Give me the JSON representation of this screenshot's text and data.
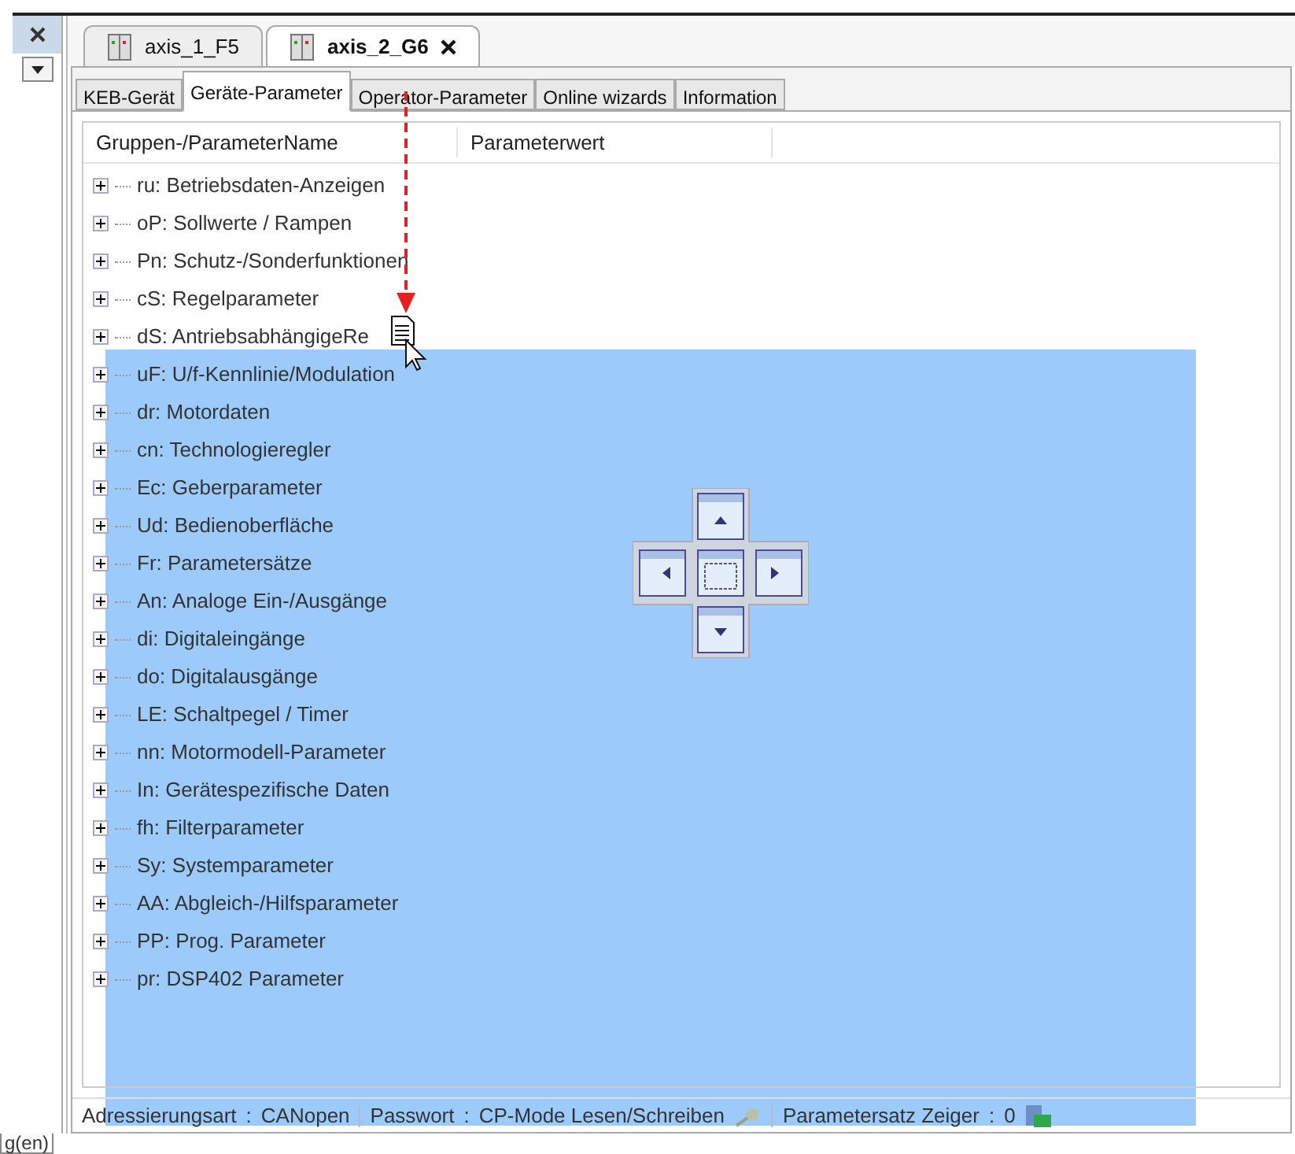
{
  "document_tabs": [
    {
      "label": "axis_1_F5",
      "selected": false
    },
    {
      "label": "axis_2_G6",
      "selected": true
    }
  ],
  "sub_tabs": [
    {
      "label": "KEB-Gerät",
      "selected": false
    },
    {
      "label": "Geräte-Parameter",
      "selected": true
    },
    {
      "label": "Operator-Parameter",
      "selected": false
    },
    {
      "label": "Online wizards",
      "selected": false
    },
    {
      "label": "Information",
      "selected": false
    }
  ],
  "columns": [
    "Gruppen-/ParameterName",
    "Parameterwert"
  ],
  "tree": [
    {
      "label": "ru: Betriebsdaten-Anzeigen",
      "expanded": false
    },
    {
      "label": "oP: Sollwerte / Rampen",
      "expanded": false
    },
    {
      "label": "Pn: Schutz-/Sonderfunktionen",
      "expanded": false
    },
    {
      "label": "cS: Regelparameter",
      "expanded": false
    },
    {
      "label": "dS: AntriebsabhängigeRe",
      "expanded": false
    },
    {
      "label": "uF: U/f-Kennlinie/Modulation",
      "expanded": false
    },
    {
      "label": "dr: Motordaten",
      "expanded": false
    },
    {
      "label": "cn: Technologieregler",
      "expanded": false
    },
    {
      "label": "Ec: Geberparameter",
      "expanded": false
    },
    {
      "label": "Ud: Bedienoberfläche",
      "expanded": false
    },
    {
      "label": "Fr: Parametersätze",
      "expanded": false
    },
    {
      "label": "An: Analoge Ein-/Ausgänge",
      "expanded": false
    },
    {
      "label": "di: Digitaleingänge",
      "expanded": false
    },
    {
      "label": "do: Digitalausgänge",
      "expanded": false
    },
    {
      "label": "LE: Schaltpegel / Timer",
      "expanded": false
    },
    {
      "label": "nn: Motormodell-Parameter",
      "expanded": false
    },
    {
      "label": "In: Gerätespezifische Daten",
      "expanded": false
    },
    {
      "label": "fh: Filterparameter",
      "expanded": false
    },
    {
      "label": "Sy: Systemparameter",
      "expanded": false
    },
    {
      "label": "AA: Abgleich-/Hilfsparameter",
      "expanded": false
    },
    {
      "label": "PP: Prog. Parameter",
      "expanded": false
    },
    {
      "label": "pr: DSP402 Parameter",
      "expanded": false
    }
  ],
  "status_bar": [
    {
      "kind": "text",
      "label": "Adressierungsart",
      "separator": ":",
      "value": "CANopen"
    },
    {
      "kind": "key",
      "label": "Passwort",
      "separator": ":",
      "value": "CP-Mode Lesen/Schreiben"
    },
    {
      "kind": "device",
      "label": "Parametersatz Zeiger",
      "separator": ":",
      "value": "0"
    }
  ],
  "dock_preview": {
    "shown": true
  },
  "bottom_tab": "g(en)"
}
